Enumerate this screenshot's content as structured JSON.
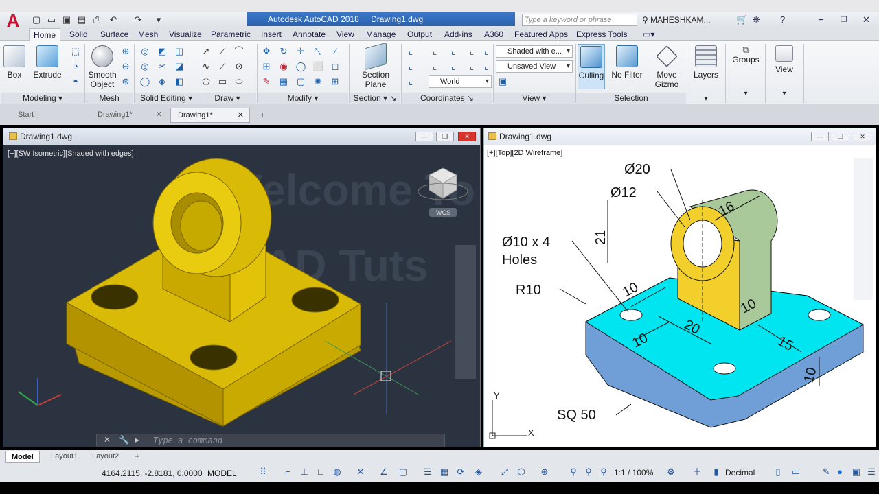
{
  "window": {
    "app_title": "Autodesk AutoCAD 2018",
    "file_title": "Drawing1.dwg",
    "search_placeholder": "Type a keyword or phrase",
    "user": "MAHESHKAM...",
    "logo": "A"
  },
  "ribbon_tabs": [
    "Home",
    "Solid",
    "Surface",
    "Mesh",
    "Visualize",
    "Parametric",
    "Insert",
    "Annotate",
    "View",
    "Manage",
    "Output",
    "Add-ins",
    "A360",
    "Featured Apps",
    "Express Tools"
  ],
  "ribbon": {
    "buttons": {
      "box": "Box",
      "extrude": "Extrude",
      "smooth_object_1": "Smooth",
      "smooth_object_2": "Object",
      "section_plane_1": "Section",
      "section_plane_2": "Plane",
      "culling": "Culling",
      "no_filter": "No Filter",
      "move_gizmo_1": "Move",
      "move_gizmo_2": "Gizmo",
      "layers": "Layers",
      "groups": "Groups",
      "view": "View"
    },
    "dropdowns": {
      "visual_style": "Shaded with e...",
      "named_view": "Unsaved View",
      "ucs": "World"
    },
    "panels": {
      "modeling": "Modeling",
      "mesh": "Mesh",
      "solid_editing": "Solid Editing",
      "draw": "Draw",
      "modify": "Modify",
      "section": "Section",
      "coordinates": "Coordinates",
      "view": "View",
      "selection": "Selection"
    }
  },
  "doc_tabs": [
    "Start",
    "Drawing1*",
    "Drawing1*"
  ],
  "viewport_left": {
    "title": "Drawing1.dwg",
    "label": "[−][SW Isometric][Shaded with edges]",
    "viewcube_label": "WCS",
    "watermark_1": "Welcome To",
    "watermark_2": "A_CAD Tuts",
    "command_placeholder": "Type a command"
  },
  "viewport_right": {
    "title": "Drawing1.dwg",
    "label": "[+][Top][2D Wireframe]",
    "annotations": {
      "d20": "Ø20",
      "d12": "Ø12",
      "holes_1": "Ø10 x 4",
      "holes_2": "Holes",
      "r10": "R10",
      "sq50": "SQ 50",
      "dim_21": "21",
      "dim_16": "16",
      "dim_10a": "10",
      "dim_10b": "10",
      "dim_10c": "10",
      "dim_20": "20",
      "dim_15": "15",
      "dim_10d": "10"
    },
    "ucs_x": "X",
    "ucs_y": "Y"
  },
  "layout_tabs": [
    "Model",
    "Layout1",
    "Layout2"
  ],
  "status": {
    "coords": "4164.2115, -2.8181, 0.0000",
    "space": "MODEL",
    "scale": "1:1 / 100%",
    "units": "Decimal"
  },
  "colors": {
    "solid_yellow": "#d4b400",
    "viewport_bg": "#2b3340",
    "cyan_top": "#00e5f0",
    "blue_side": "#6f9fd6",
    "green_face": "#a9c99a",
    "yellow_face": "#f2cf2a"
  }
}
